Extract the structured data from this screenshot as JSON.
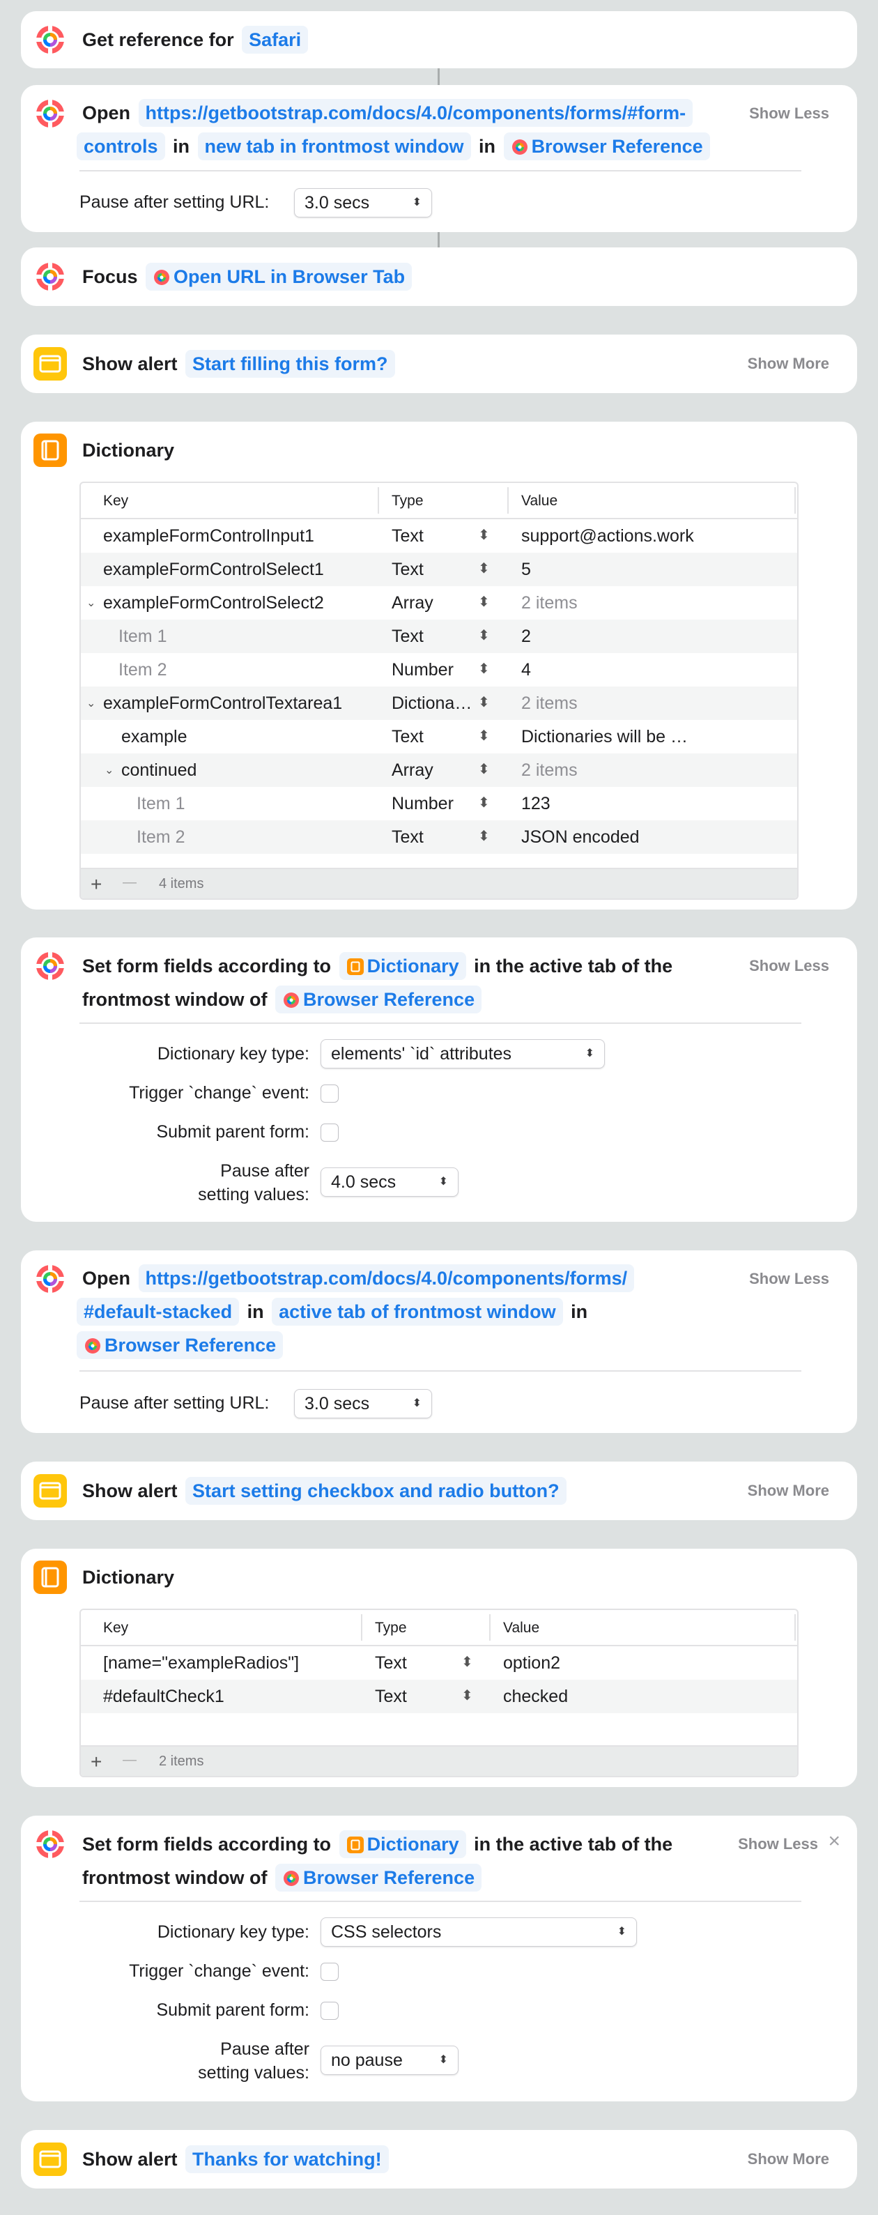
{
  "steps": {
    "s1": {
      "verb": "Get reference for",
      "target": "Safari"
    },
    "s2": {
      "verb": "Open",
      "url_line1": "https://getbootstrap.com/docs/4.0/components/forms/#form-",
      "url_line2": "controls",
      "in1": "in",
      "tab": "new tab in frontmost window",
      "in2": "in",
      "browser": "Browser Reference",
      "toggle": "Show Less",
      "pause_label": "Pause after setting URL:",
      "pause_value": "3.0 secs"
    },
    "s3": {
      "verb": "Focus",
      "target": "Open URL in Browser Tab"
    },
    "s4": {
      "verb": "Show alert",
      "message": "Start filling this form?",
      "toggle": "Show More"
    },
    "s5": {
      "title": "Dictionary",
      "headers": {
        "key": "Key",
        "type": "Type",
        "value": "Value"
      },
      "rows": [
        {
          "key": "exampleFormControlInput1",
          "type": "Text",
          "value": "support@actions.work"
        },
        {
          "key": "exampleFormControlSelect1",
          "type": "Text",
          "value": "5"
        },
        {
          "key": "exampleFormControlSelect2",
          "type": "Array",
          "value": "2 items"
        },
        {
          "key": "Item 1",
          "type": "Text",
          "value": "2"
        },
        {
          "key": "Item 2",
          "type": "Number",
          "value": "4"
        },
        {
          "key": "exampleFormControlTextarea1",
          "type": "Dictiona…",
          "value": "2 items"
        },
        {
          "key": "example",
          "type": "Text",
          "value": "Dictionaries will be …"
        },
        {
          "key": "continued",
          "type": "Array",
          "value": "2 items"
        },
        {
          "key": "Item 1",
          "type": "Number",
          "value": "123"
        },
        {
          "key": "Item 2",
          "type": "Text",
          "value": "JSON encoded"
        }
      ],
      "count": "4 items",
      "add": "+",
      "remove": "—"
    },
    "s6": {
      "verb": "Set form fields according to",
      "dict": "Dictionary",
      "rest1": "in the active tab of the",
      "rest2": "frontmost window of",
      "browser": "Browser Reference",
      "toggle": "Show Less",
      "key_type_label": "Dictionary key type:",
      "key_type_value": "elements' `id` attributes",
      "trigger_label": "Trigger `change` event:",
      "submit_label": "Submit parent form:",
      "pause_label_1": "Pause after",
      "pause_label_2": "setting values:",
      "pause_value": "4.0 secs"
    },
    "s7": {
      "verb": "Open",
      "url_line1": "https://getbootstrap.com/docs/4.0/components/forms/",
      "url_line2": "#default-stacked",
      "in1": "in",
      "tab": "active tab of frontmost window",
      "in2": "in",
      "browser": "Browser Reference",
      "toggle": "Show Less",
      "pause_label": "Pause after setting URL:",
      "pause_value": "3.0 secs"
    },
    "s8": {
      "verb": "Show alert",
      "message": "Start setting checkbox and radio button?",
      "toggle": "Show More"
    },
    "s9": {
      "title": "Dictionary",
      "headers": {
        "key": "Key",
        "type": "Type",
        "value": "Value"
      },
      "rows": [
        {
          "key": "[name=\"exampleRadios\"]",
          "type": "Text",
          "value": "option2"
        },
        {
          "key": "#defaultCheck1",
          "type": "Text",
          "value": "checked"
        }
      ],
      "count": "2 items",
      "add": "+",
      "remove": "—"
    },
    "s10": {
      "verb": "Set form fields according to",
      "dict": "Dictionary",
      "rest1": "in the active tab of the",
      "rest2": "frontmost window of",
      "browser": "Browser Reference",
      "toggle": "Show Less",
      "close": "×",
      "key_type_label": "Dictionary key type:",
      "key_type_value": "CSS selectors",
      "trigger_label": "Trigger `change` event:",
      "submit_label": "Submit parent form:",
      "pause_label_1": "Pause after",
      "pause_label_2": "setting values:",
      "pause_value": "no pause"
    },
    "s11": {
      "verb": "Show alert",
      "message": "Thanks for watching!",
      "toggle": "Show More"
    }
  },
  "colors": {
    "accent": "#1c7be8",
    "background": "#dde1e1",
    "alert_yellow": "#ffc60b",
    "dict_orange": "#ff9500"
  },
  "icons": {
    "gear": "actions-gear-icon",
    "alert": "alert-window-icon",
    "dictionary": "book-icon",
    "updown": "up-down-chevron-icon"
  }
}
